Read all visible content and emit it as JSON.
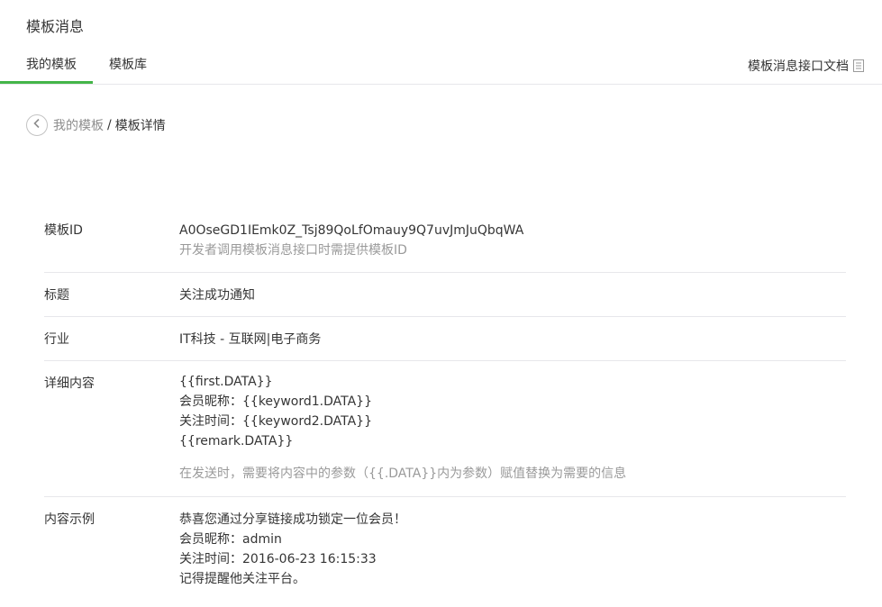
{
  "header": {
    "title": "模板消息"
  },
  "tabs": [
    {
      "label": "我的模板",
      "active": true
    },
    {
      "label": "模板库",
      "active": false
    }
  ],
  "doc_link": {
    "label": "模板消息接口文档",
    "icon": "document-icon"
  },
  "breadcrumb": {
    "back_icon": "chevron-left-icon",
    "parent": "我的模板",
    "separator": "/",
    "current": "模板详情"
  },
  "detail": {
    "template_id": {
      "label": "模板ID",
      "value": "A0OseGD1IEmk0Z_Tsj89QoLfOmauy9Q7uvJmJuQbqWA",
      "hint": "开发者调用模板消息接口时需提供模板ID"
    },
    "title": {
      "label": "标题",
      "value": "关注成功通知"
    },
    "industry": {
      "label": "行业",
      "value": "IT科技 - 互联网|电子商务"
    },
    "content": {
      "label": "详细内容",
      "lines": [
        "{{first.DATA}}",
        "会员昵称：{{keyword1.DATA}}",
        "关注时间：{{keyword2.DATA}}",
        "{{remark.DATA}}"
      ],
      "hint": "在发送时，需要将内容中的参数（{{.DATA}}内为参数）赋值替换为需要的信息"
    },
    "example": {
      "label": "内容示例",
      "lines": [
        "恭喜您通过分享链接成功锁定一位会员！",
        "会员昵称：admin",
        "关注时间：2016-06-23 16:15:33",
        "记得提醒他关注平台。"
      ]
    }
  },
  "colors": {
    "accent": "#44b549",
    "text": "#353535",
    "muted": "#9a9a9a",
    "border": "#e7e7eb"
  }
}
